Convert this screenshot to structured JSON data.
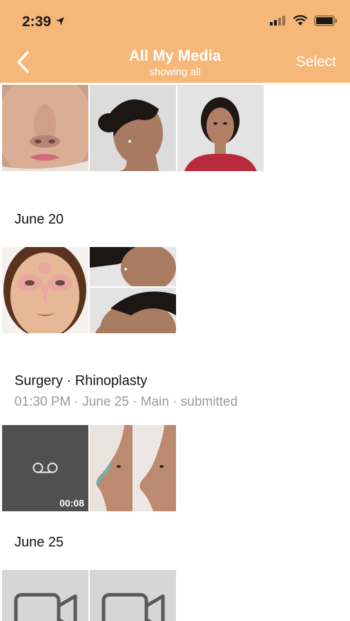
{
  "status_bar": {
    "time": "2:39"
  },
  "nav": {
    "title": "All My Media",
    "subtitle": "showing all",
    "select_label": "Select"
  },
  "sections": [
    {
      "title": "June 20"
    },
    {
      "title": "Surgery · Rhinoplasty",
      "subtitle": "01:30 PM · June 25 ·  Main · submitted"
    },
    {
      "title": "June 25"
    }
  ],
  "voicemail": {
    "duration": "00:08"
  },
  "colors": {
    "header": "#f6b879",
    "subtext": "#9a9a9a"
  }
}
